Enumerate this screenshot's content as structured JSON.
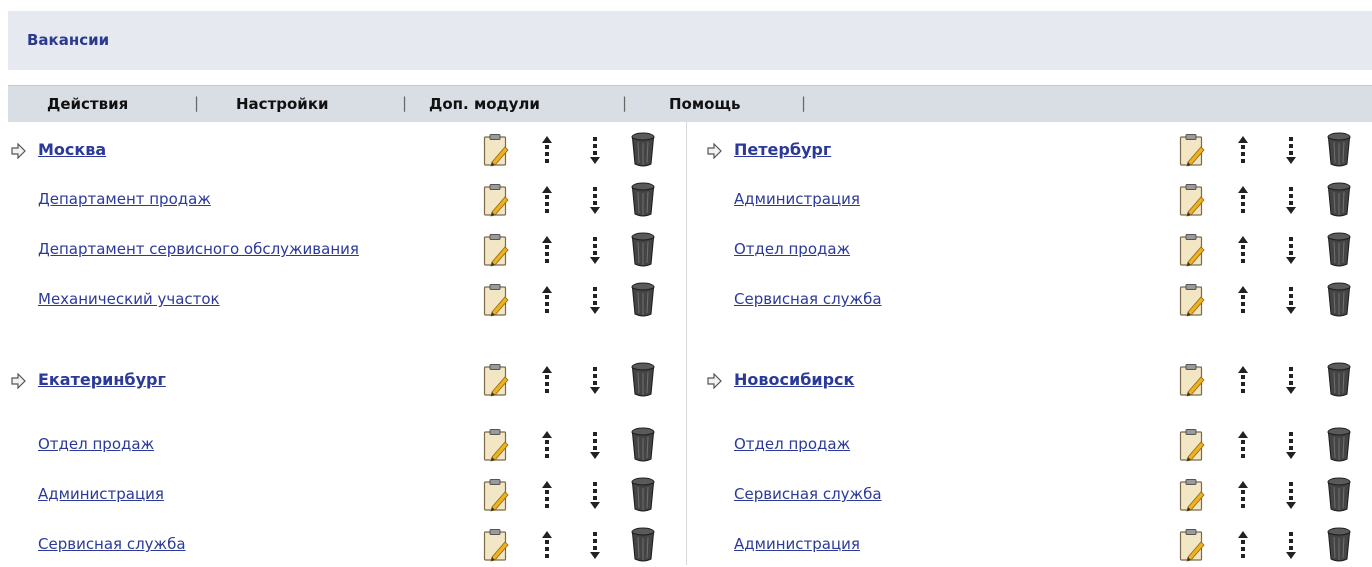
{
  "header": {
    "title": "Вакансии"
  },
  "menu": {
    "items": [
      {
        "label": "Действия"
      },
      {
        "label": "Настройки"
      },
      {
        "label": "Доп. модули"
      },
      {
        "label": "Помощь"
      }
    ],
    "separator": "|"
  },
  "columns": [
    {
      "groups": [
        {
          "city": "Москва",
          "departments": [
            "Департамент продаж",
            "Департамент сервисного обслуживания",
            "Механический участок"
          ]
        },
        {
          "city": "Екатеринбург",
          "departments": [
            "Отдел продаж",
            "Администрация",
            "Сервисная служба"
          ]
        }
      ]
    },
    {
      "groups": [
        {
          "city": "Петербург",
          "departments": [
            "Администрация",
            "Отдел продаж",
            "Сервисная служба"
          ]
        },
        {
          "city": "Новосибирск",
          "departments": [
            "Отдел продаж",
            "Сервисная служба",
            "Администрация"
          ]
        }
      ]
    }
  ],
  "icons": {
    "edit": "edit-icon",
    "up": "move-up-icon",
    "down": "move-down-icon",
    "delete": "delete-icon",
    "arrow": "arrow-right-icon"
  },
  "colors": {
    "link": "#2b3a9a",
    "header_bg": "#e6e9ef",
    "menu_bg": "#d9dde4"
  }
}
